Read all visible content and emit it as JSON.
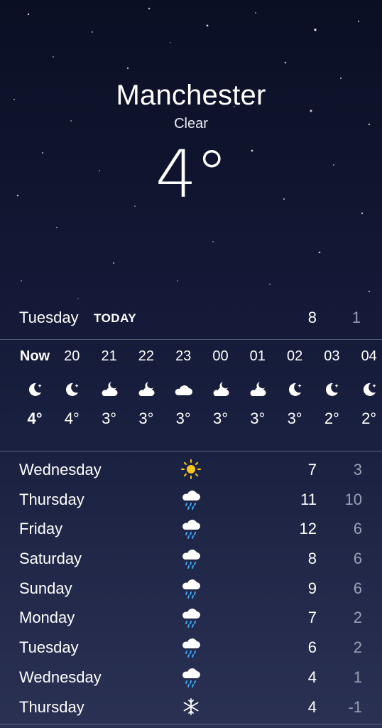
{
  "header": {
    "city": "Manchester",
    "condition": "Clear",
    "temperature": "4°"
  },
  "today": {
    "day": "Tuesday",
    "tag": "TODAY",
    "high": "8",
    "low": "1"
  },
  "hourly": [
    {
      "hour": "Now",
      "icon": "moon-icon",
      "temp": "4°"
    },
    {
      "hour": "20",
      "icon": "moon-icon",
      "temp": "4°"
    },
    {
      "hour": "21",
      "icon": "partly-cloudy-night-icon",
      "temp": "3°"
    },
    {
      "hour": "22",
      "icon": "partly-cloudy-night-icon",
      "temp": "3°"
    },
    {
      "hour": "23",
      "icon": "cloud-icon",
      "temp": "3°"
    },
    {
      "hour": "00",
      "icon": "partly-cloudy-night-icon",
      "temp": "3°"
    },
    {
      "hour": "01",
      "icon": "partly-cloudy-night-icon",
      "temp": "3°"
    },
    {
      "hour": "02",
      "icon": "moon-icon",
      "temp": "3°"
    },
    {
      "hour": "03",
      "icon": "moon-icon",
      "temp": "2°"
    },
    {
      "hour": "04",
      "icon": "moon-icon",
      "temp": "2°"
    }
  ],
  "daily": [
    {
      "day": "Wednesday",
      "icon": "sun-icon",
      "high": "7",
      "low": "3"
    },
    {
      "day": "Thursday",
      "icon": "rain-icon",
      "high": "11",
      "low": "10"
    },
    {
      "day": "Friday",
      "icon": "rain-icon",
      "high": "12",
      "low": "6"
    },
    {
      "day": "Saturday",
      "icon": "rain-icon",
      "high": "8",
      "low": "6"
    },
    {
      "day": "Sunday",
      "icon": "rain-icon",
      "high": "9",
      "low": "6"
    },
    {
      "day": "Monday",
      "icon": "rain-icon",
      "high": "7",
      "low": "2"
    },
    {
      "day": "Tuesday",
      "icon": "rain-icon",
      "high": "6",
      "low": "2"
    },
    {
      "day": "Wednesday",
      "icon": "rain-icon",
      "high": "4",
      "low": "1"
    },
    {
      "day": "Thursday",
      "icon": "snow-icon",
      "high": "4",
      "low": "-1"
    }
  ],
  "colors": {
    "sun": "#f7c81e",
    "rain": "#3ea6f0",
    "low_temp": "#9aa0b4"
  }
}
